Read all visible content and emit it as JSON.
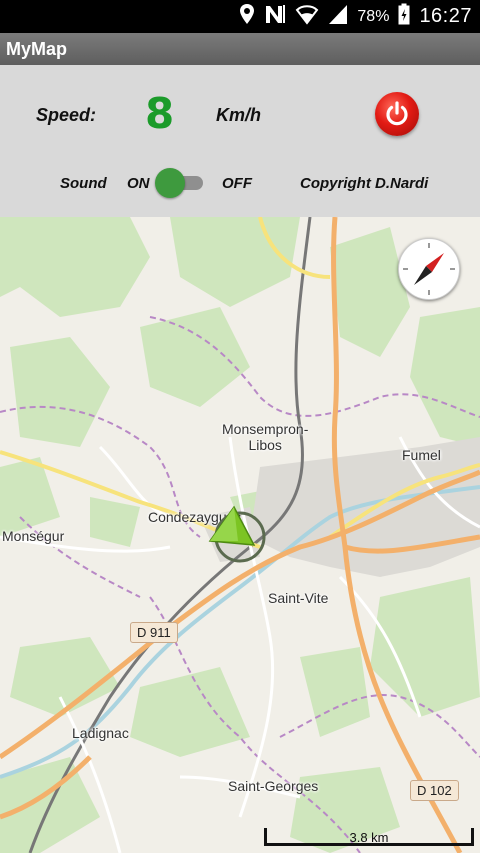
{
  "status_bar": {
    "battery_percent": "78%",
    "time": "16:27",
    "icons": [
      "location-icon",
      "nfc-icon",
      "wifi-icon",
      "signal-icon",
      "battery-icon"
    ]
  },
  "app": {
    "title": "MyMap"
  },
  "panel": {
    "speed_label": "Speed:",
    "speed_value": "8",
    "speed_unit": "Km/h",
    "sound_label": "Sound",
    "on_label": "ON",
    "off_label": "OFF",
    "sound_on": true,
    "copyright": "Copyright D.Nardi",
    "power_color": "#e21b14",
    "speed_color": "#1b9b2a"
  },
  "map": {
    "places": {
      "monsempron": "Monsempron-\nLibos",
      "fumel": "Fumel",
      "condezaygues": "Condezaygues",
      "monsegur": "Monségur",
      "saint_vite": "Saint-Vite",
      "ladignac": "Ladignac",
      "saint_georges": "Saint-Georges"
    },
    "roads": {
      "d911": "D 911",
      "d102": "D 102"
    },
    "scale": "3.8 km",
    "position_marker_color": "#6cc21a"
  }
}
